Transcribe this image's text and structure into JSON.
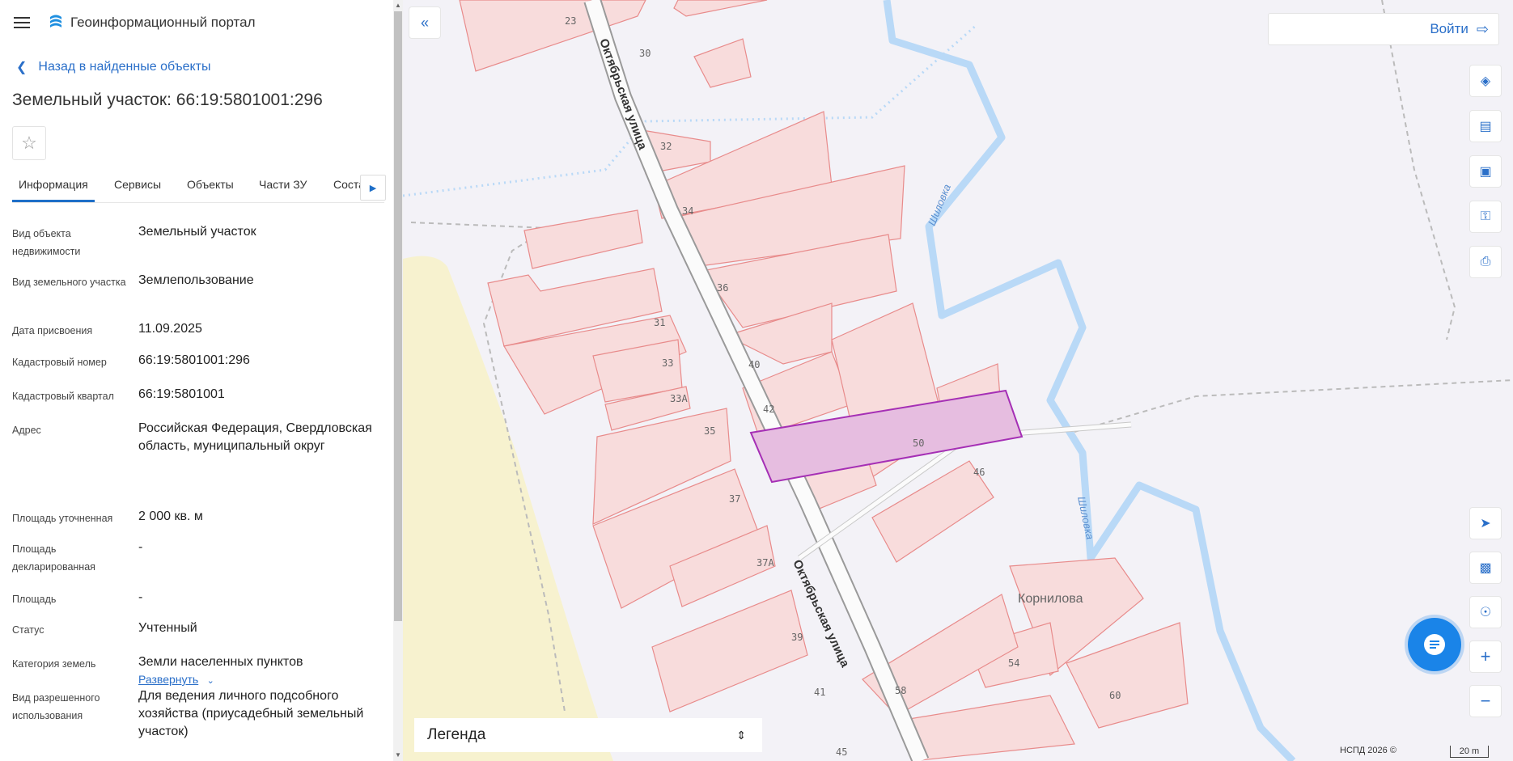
{
  "app": {
    "title": "Геоинформационный портал"
  },
  "nav": {
    "back_label": "Назад в найденные объекты"
  },
  "object": {
    "heading": "Земельный участок: 66:19:5801001:296"
  },
  "tabs": [
    {
      "label": "Информация"
    },
    {
      "label": "Сервисы"
    },
    {
      "label": "Объекты"
    },
    {
      "label": "Части ЗУ"
    },
    {
      "label": "Соста"
    }
  ],
  "props": [
    {
      "label": "Вид объекта недвижимости",
      "value": "Земельный участок"
    },
    {
      "label": "Вид земельного участка",
      "value": "Землепользование"
    },
    {
      "label": "Дата присвоения",
      "value": "11.09.2025"
    },
    {
      "label": "Кадастровый номер",
      "value": "66:19:5801001:296"
    },
    {
      "label": "Кадастровый квартал",
      "value": "66:19:5801001"
    },
    {
      "label": "Адрес",
      "value": "Российская Федерация, Свердловская область, муниципальный округ"
    },
    {
      "label": "Площадь уточненная",
      "value": "2 000 кв. м"
    },
    {
      "label": "Площадь декларированная",
      "value": "-"
    },
    {
      "label": "Площадь",
      "value": "-"
    },
    {
      "label": "Статус",
      "value": "Учтенный"
    },
    {
      "label": "Категория земель",
      "value": "Земли населенных пунктов"
    },
    {
      "label": "Вид разрешенного использования",
      "value": "Для ведения личного подсобного хозяйства (приусадебный земельный участок)"
    }
  ],
  "address_expand": "Развернуть",
  "map": {
    "login_label": "Войти",
    "legend_label": "Легенда",
    "copyright": "НСПД 2026 ©",
    "scale_label": "20 m",
    "streets": [
      "Октябрьская улица",
      "Октябрьская улица"
    ],
    "rivers": [
      "Шиловка",
      "Шиловка"
    ],
    "place": "Корнилова",
    "house_numbers": [
      "23",
      "30",
      "32",
      "34",
      "36",
      "31",
      "33",
      "33А",
      "40",
      "42",
      "35",
      "50",
      "46",
      "37",
      "37А",
      "39",
      "41",
      "45",
      "54",
      "58",
      "60"
    ]
  },
  "colors": {
    "accent": "#1f6fc8",
    "parcel_fill": "#f8dcdc",
    "parcel_stroke": "#e88b8b",
    "selected_fill": "#e6bde0",
    "selected_stroke": "#a52fb5",
    "river": "#b9d9f7",
    "sand": "#f7f2cf"
  }
}
